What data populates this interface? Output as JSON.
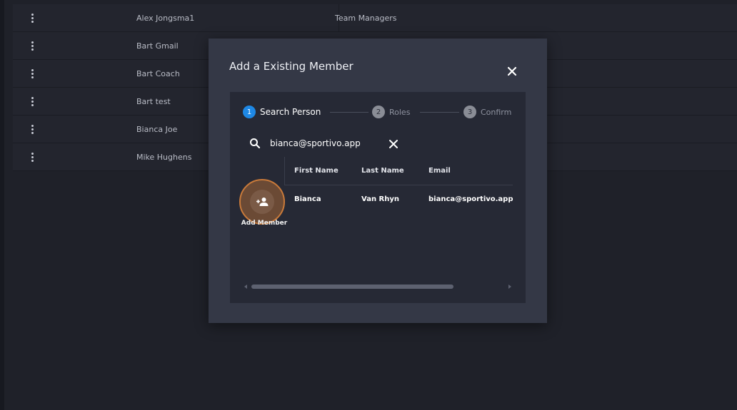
{
  "background_table": {
    "rows": [
      {
        "name": "Alex Jongsma1",
        "group": "Team Managers"
      },
      {
        "name": "Bart Gmail",
        "group": ""
      },
      {
        "name": "Bart Coach",
        "group": ""
      },
      {
        "name": "Bart test",
        "group": ""
      },
      {
        "name": "Bianca Joe",
        "group": ""
      },
      {
        "name": "Mike Hughens",
        "group": ""
      }
    ]
  },
  "modal": {
    "title": "Add a Existing Member",
    "stepper": [
      {
        "num": "1",
        "label": "Search Person",
        "active": true
      },
      {
        "num": "2",
        "label": "Roles",
        "active": false
      },
      {
        "num": "3",
        "label": "Confirm",
        "active": false
      }
    ],
    "search": {
      "value": "bianca@sportivo.app",
      "icon": "search-icon"
    },
    "results": {
      "columns": [
        "First Name",
        "Last Name",
        "Email"
      ],
      "rows": [
        {
          "first_name": "Bianca",
          "last_name": "Van Rhyn",
          "email": "bianca@sportivo.app"
        }
      ],
      "add_member_label": "Add Member"
    }
  },
  "colors": {
    "accent": "#1e88e5",
    "modal_bg": "#343846",
    "highlight": "#c97a3a"
  }
}
